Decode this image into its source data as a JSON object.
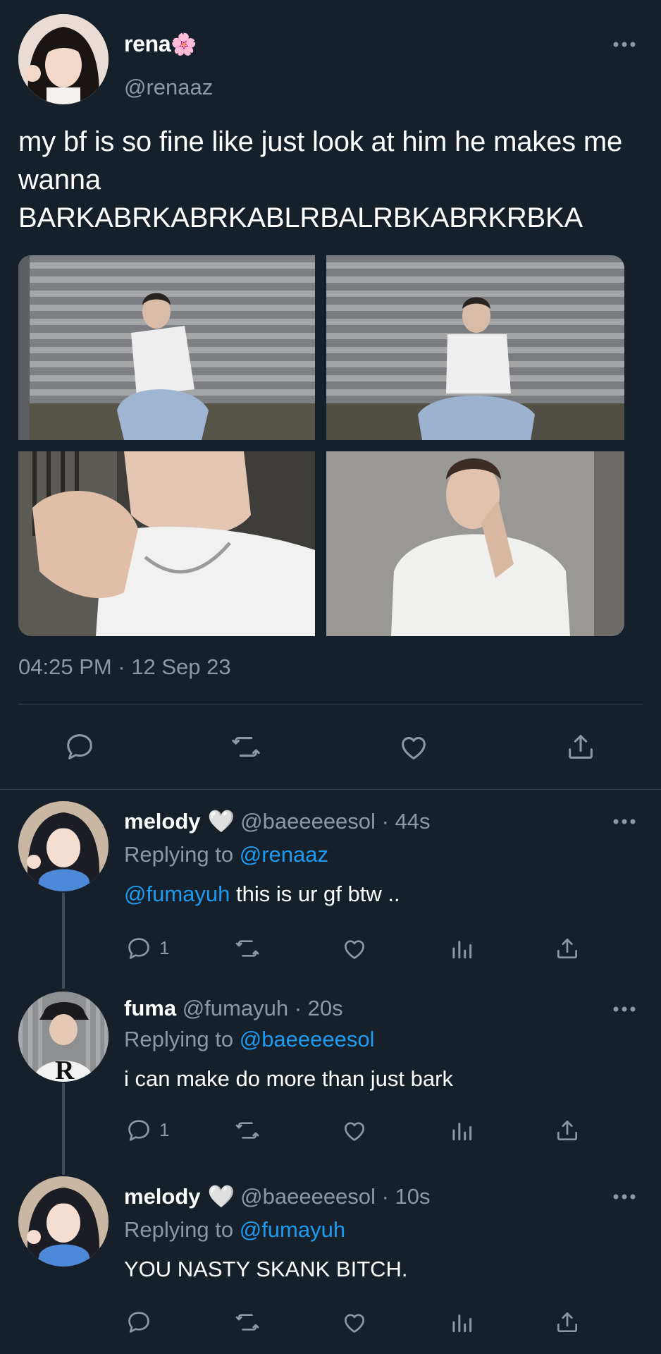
{
  "main_tweet": {
    "author_name": "rena",
    "author_emoji": "🌸",
    "author_handle": "@renaaz",
    "text": "my bf is so fine like just look at him he makes me wanna BARKABRKABRKABLRBALRBKABRKRBKA",
    "timestamp": "04:25 PM · 12 Sep 23",
    "photos": [
      "photo-1",
      "photo-2",
      "photo-3",
      "photo-4"
    ],
    "actions": [
      "reply-icon",
      "retweet-icon",
      "like-icon",
      "share-icon"
    ]
  },
  "replies": [
    {
      "name": "melody",
      "heart": "🤍",
      "handle": "@baeeeeesol",
      "time": "· 44s",
      "replying_prefix": "Replying to",
      "replying_to": "@renaaz",
      "mention": "@fumayuh",
      "text": " this is ur gf btw ..",
      "reply_count": "1"
    },
    {
      "name": "fuma",
      "handle": "@fumayuh",
      "time": "· 20s",
      "replying_prefix": "Replying to",
      "replying_to": "@baeeeeesol",
      "text": "i can make do more than just bark",
      "reply_count": "1"
    },
    {
      "name": "melody",
      "heart": "🤍",
      "handle": "@baeeeeesol",
      "time": "· 10s",
      "replying_prefix": "Replying to",
      "replying_to": "@fumayuh",
      "text": "YOU NASTY SKANK BITCH."
    }
  ],
  "colors": {
    "background": "#15202b",
    "text": "#ffffff",
    "secondary": "#8b98a5",
    "link": "#1d9bf0",
    "divider": "#38444d"
  }
}
